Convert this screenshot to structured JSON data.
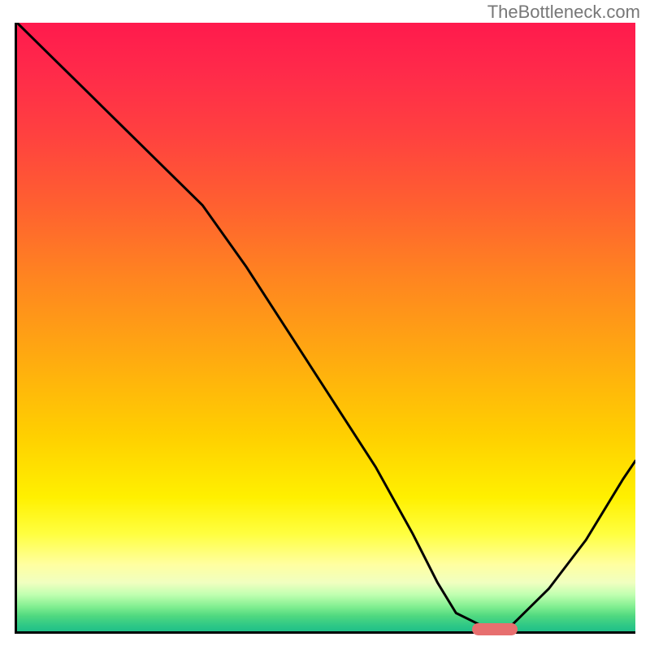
{
  "watermark": "TheBottleneck.com",
  "chart_data": {
    "type": "line",
    "title": "",
    "xlabel": "",
    "ylabel": "",
    "xlim": [
      0,
      100
    ],
    "ylim": [
      0,
      100
    ],
    "series": [
      {
        "name": "bottleneck-curve",
        "x": [
          0,
          6,
          12,
          18,
          24,
          30,
          37,
          44,
          51,
          58,
          64,
          68,
          71,
          75,
          80,
          86,
          92,
          98,
          100
        ],
        "values": [
          100,
          94,
          88,
          82,
          76,
          70,
          60,
          49,
          38,
          27,
          16,
          8,
          3,
          1,
          1,
          7,
          15,
          25,
          28
        ]
      }
    ],
    "marker": {
      "x": 77,
      "y": 0.8,
      "label": ""
    },
    "background_gradient": {
      "stops": [
        {
          "pos": 0,
          "color": "#ff1a4d"
        },
        {
          "pos": 50,
          "color": "#ffaa10"
        },
        {
          "pos": 85,
          "color": "#ffff60"
        },
        {
          "pos": 100,
          "color": "#20c088"
        }
      ]
    }
  }
}
